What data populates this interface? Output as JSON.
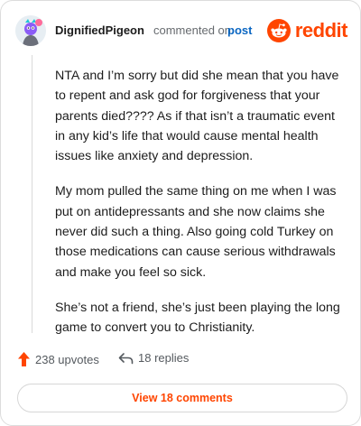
{
  "comment": {
    "username": "DignifiedPigeon",
    "action_text": "commented on",
    "post_link": "post",
    "paragraphs": [
      "NTA and I’m sorry but did she mean that you have to repent and ask god for forgiveness that your parents died???? As if that isn’t a traumatic event in any kid’s life that would cause mental health issues like anxiety and depression.",
      "My mom pulled the same thing on me when I was put on antidepressants and she now claims she never did such a thing. Also going cold Turkey on those medications can cause serious withdrawals and make you feel so sick.",
      "She’s not a friend, she’s just been playing the long game to convert you to Christianity."
    ]
  },
  "brand": {
    "logo_text": "reddit",
    "color": "#ff4500"
  },
  "actions": {
    "upvotes": "238 upvotes",
    "replies": "18 replies",
    "view_comments": "View 18 comments"
  },
  "icons": {
    "avatar": "avatar-icon",
    "logo": "reddit-snoo-icon",
    "upvote": "upvote-arrow-icon",
    "reply": "reply-arrow-icon"
  },
  "colors": {
    "accent": "#ff4500",
    "link": "#0a66c2",
    "text": "#1c1c1c",
    "muted": "#666a6e"
  }
}
